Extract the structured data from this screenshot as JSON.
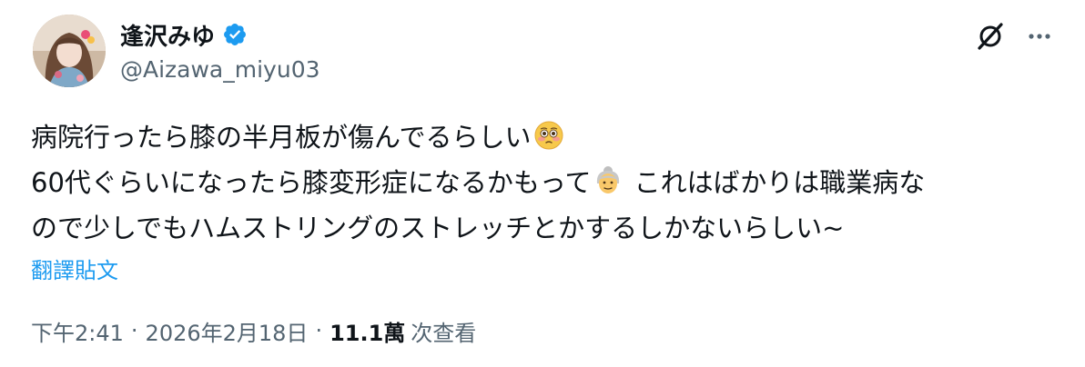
{
  "author": {
    "display_name": "逢沢みゆ",
    "handle": "@Aizawa_miyu03",
    "verified": true
  },
  "tweet": {
    "lines": [
      {
        "text": "病院行ったら膝の半月板が傷んでるらしい",
        "emoji": "flushed-face-emoji"
      },
      {
        "text": "60代ぐらいになったら膝変形症になるかもって",
        "emoji": "older-woman-emoji",
        "after": "これはばかりは職業病な"
      },
      {
        "text": "ので少しでもハムストリングのストレッチとかするしかないらしい~"
      }
    ],
    "translate_label": "翻譯貼文"
  },
  "meta": {
    "time": "下午2:41",
    "separator": "·",
    "date": "2026年2月18日",
    "views_count": "11.1萬",
    "views_label": "次查看"
  },
  "icons": {
    "grok": "grok-icon",
    "more": "more-icon",
    "verified": "verified-badge-icon"
  },
  "colors": {
    "text": "#0f1419",
    "secondary": "#536471",
    "link": "#1d9bf0",
    "verified": "#1d9bf0"
  }
}
